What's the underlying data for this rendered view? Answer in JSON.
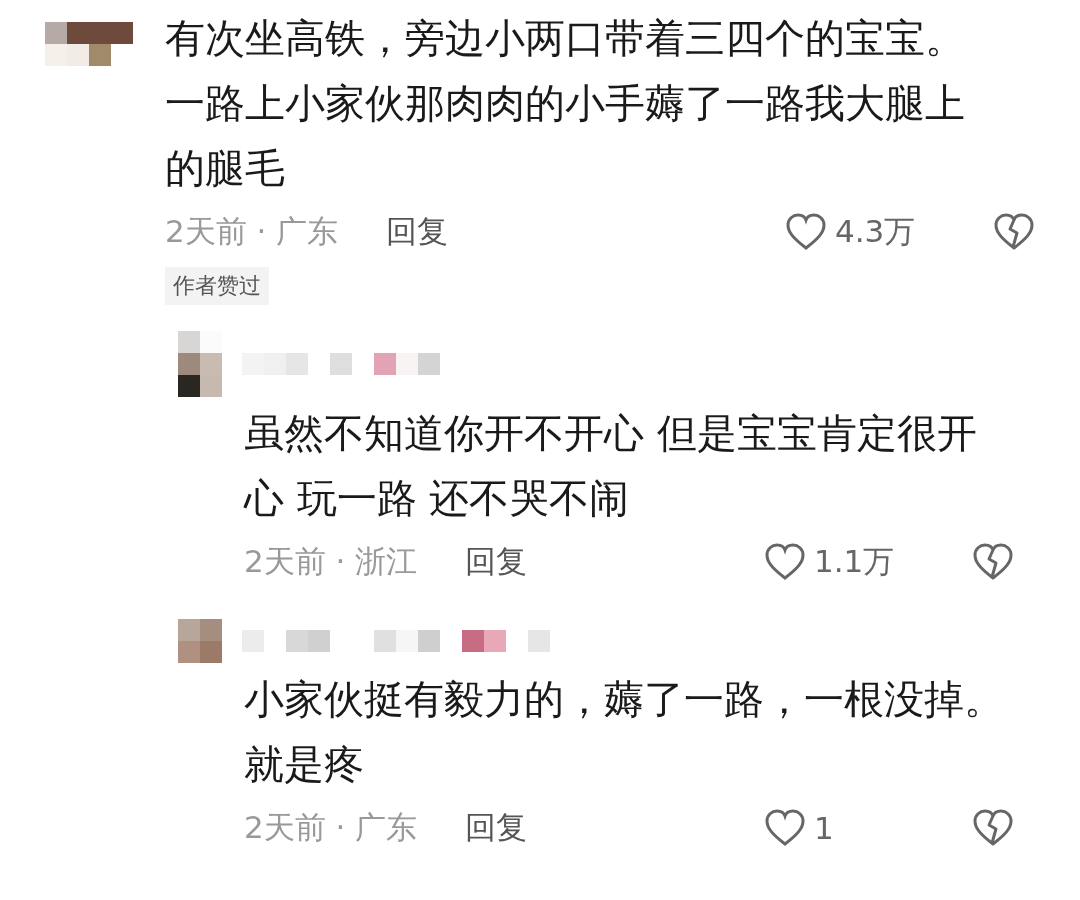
{
  "comment": {
    "text": "有次坐高铁，旁边小两口带着三四个的宝宝。一路上小家伙那肉肉的小手薅了一路我大腿上的腿毛",
    "meta": "2天前 · 广东",
    "reply_label": "回复",
    "likes": "4.3万",
    "tag": "作者赞过",
    "replies": [
      {
        "text": "虽然不知道你开不开心 但是宝宝肯定很开心 玩一路 还不哭不闹",
        "meta": "2天前 · 浙江",
        "reply_label": "回复",
        "likes": "1.1万"
      },
      {
        "text": "小家伙挺有毅力的，薅了一路，一根没掉。就是疼",
        "meta": "2天前 · 广东",
        "reply_label": "回复",
        "likes": "1"
      }
    ]
  }
}
